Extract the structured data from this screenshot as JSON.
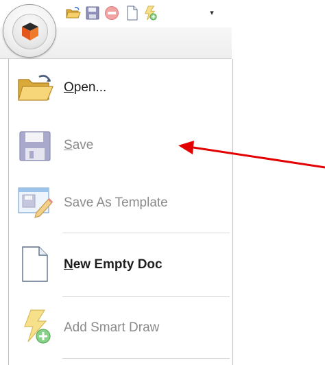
{
  "quick_access_toolbar": {
    "icons": [
      "open-folder-icon",
      "save-disk-icon",
      "stop-icon",
      "new-document-icon",
      "smart-draw-icon"
    ],
    "more_glyph": "▾"
  },
  "app_button": {
    "icon": "orange-cube-logo"
  },
  "menu": {
    "items": [
      {
        "icon": "open-folder-icon",
        "accel": "O",
        "rest": "pen...",
        "state": "enabled"
      },
      {
        "icon": "save-disk-icon",
        "accel": "S",
        "rest": "ave",
        "state": "disabled"
      },
      {
        "icon": "save-as-template-icon",
        "text": "Save As Template",
        "state": "disabled"
      },
      {
        "icon": "new-document-icon",
        "accel": "N",
        "rest": "ew Empty Doc",
        "state": "enabled"
      },
      {
        "icon": "smart-draw-icon",
        "text": "Add Smart Draw",
        "state": "disabled"
      }
    ]
  },
  "colors": {
    "annotation_arrow": "#e30000",
    "disabled_text": "#8a8a8a",
    "enabled_text": "#1e1e1e"
  }
}
